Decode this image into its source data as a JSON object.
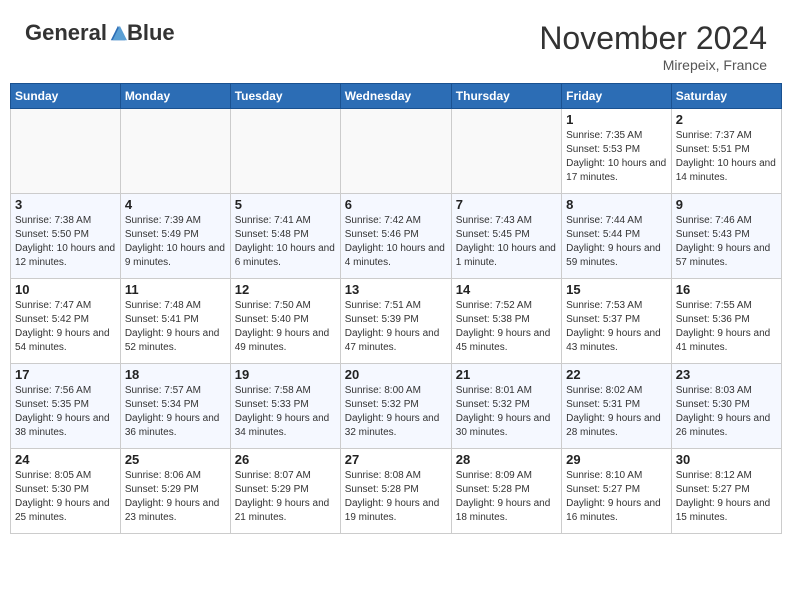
{
  "header": {
    "logo_general": "General",
    "logo_blue": "Blue",
    "month_title": "November 2024",
    "location": "Mirepeix, France"
  },
  "days_of_week": [
    "Sunday",
    "Monday",
    "Tuesday",
    "Wednesday",
    "Thursday",
    "Friday",
    "Saturday"
  ],
  "weeks": [
    [
      {
        "day": "",
        "info": ""
      },
      {
        "day": "",
        "info": ""
      },
      {
        "day": "",
        "info": ""
      },
      {
        "day": "",
        "info": ""
      },
      {
        "day": "",
        "info": ""
      },
      {
        "day": "1",
        "info": "Sunrise: 7:35 AM\nSunset: 5:53 PM\nDaylight: 10 hours and 17 minutes."
      },
      {
        "day": "2",
        "info": "Sunrise: 7:37 AM\nSunset: 5:51 PM\nDaylight: 10 hours and 14 minutes."
      }
    ],
    [
      {
        "day": "3",
        "info": "Sunrise: 7:38 AM\nSunset: 5:50 PM\nDaylight: 10 hours and 12 minutes."
      },
      {
        "day": "4",
        "info": "Sunrise: 7:39 AM\nSunset: 5:49 PM\nDaylight: 10 hours and 9 minutes."
      },
      {
        "day": "5",
        "info": "Sunrise: 7:41 AM\nSunset: 5:48 PM\nDaylight: 10 hours and 6 minutes."
      },
      {
        "day": "6",
        "info": "Sunrise: 7:42 AM\nSunset: 5:46 PM\nDaylight: 10 hours and 4 minutes."
      },
      {
        "day": "7",
        "info": "Sunrise: 7:43 AM\nSunset: 5:45 PM\nDaylight: 10 hours and 1 minute."
      },
      {
        "day": "8",
        "info": "Sunrise: 7:44 AM\nSunset: 5:44 PM\nDaylight: 9 hours and 59 minutes."
      },
      {
        "day": "9",
        "info": "Sunrise: 7:46 AM\nSunset: 5:43 PM\nDaylight: 9 hours and 57 minutes."
      }
    ],
    [
      {
        "day": "10",
        "info": "Sunrise: 7:47 AM\nSunset: 5:42 PM\nDaylight: 9 hours and 54 minutes."
      },
      {
        "day": "11",
        "info": "Sunrise: 7:48 AM\nSunset: 5:41 PM\nDaylight: 9 hours and 52 minutes."
      },
      {
        "day": "12",
        "info": "Sunrise: 7:50 AM\nSunset: 5:40 PM\nDaylight: 9 hours and 49 minutes."
      },
      {
        "day": "13",
        "info": "Sunrise: 7:51 AM\nSunset: 5:39 PM\nDaylight: 9 hours and 47 minutes."
      },
      {
        "day": "14",
        "info": "Sunrise: 7:52 AM\nSunset: 5:38 PM\nDaylight: 9 hours and 45 minutes."
      },
      {
        "day": "15",
        "info": "Sunrise: 7:53 AM\nSunset: 5:37 PM\nDaylight: 9 hours and 43 minutes."
      },
      {
        "day": "16",
        "info": "Sunrise: 7:55 AM\nSunset: 5:36 PM\nDaylight: 9 hours and 41 minutes."
      }
    ],
    [
      {
        "day": "17",
        "info": "Sunrise: 7:56 AM\nSunset: 5:35 PM\nDaylight: 9 hours and 38 minutes."
      },
      {
        "day": "18",
        "info": "Sunrise: 7:57 AM\nSunset: 5:34 PM\nDaylight: 9 hours and 36 minutes."
      },
      {
        "day": "19",
        "info": "Sunrise: 7:58 AM\nSunset: 5:33 PM\nDaylight: 9 hours and 34 minutes."
      },
      {
        "day": "20",
        "info": "Sunrise: 8:00 AM\nSunset: 5:32 PM\nDaylight: 9 hours and 32 minutes."
      },
      {
        "day": "21",
        "info": "Sunrise: 8:01 AM\nSunset: 5:32 PM\nDaylight: 9 hours and 30 minutes."
      },
      {
        "day": "22",
        "info": "Sunrise: 8:02 AM\nSunset: 5:31 PM\nDaylight: 9 hours and 28 minutes."
      },
      {
        "day": "23",
        "info": "Sunrise: 8:03 AM\nSunset: 5:30 PM\nDaylight: 9 hours and 26 minutes."
      }
    ],
    [
      {
        "day": "24",
        "info": "Sunrise: 8:05 AM\nSunset: 5:30 PM\nDaylight: 9 hours and 25 minutes."
      },
      {
        "day": "25",
        "info": "Sunrise: 8:06 AM\nSunset: 5:29 PM\nDaylight: 9 hours and 23 minutes."
      },
      {
        "day": "26",
        "info": "Sunrise: 8:07 AM\nSunset: 5:29 PM\nDaylight: 9 hours and 21 minutes."
      },
      {
        "day": "27",
        "info": "Sunrise: 8:08 AM\nSunset: 5:28 PM\nDaylight: 9 hours and 19 minutes."
      },
      {
        "day": "28",
        "info": "Sunrise: 8:09 AM\nSunset: 5:28 PM\nDaylight: 9 hours and 18 minutes."
      },
      {
        "day": "29",
        "info": "Sunrise: 8:10 AM\nSunset: 5:27 PM\nDaylight: 9 hours and 16 minutes."
      },
      {
        "day": "30",
        "info": "Sunrise: 8:12 AM\nSunset: 5:27 PM\nDaylight: 9 hours and 15 minutes."
      }
    ]
  ]
}
